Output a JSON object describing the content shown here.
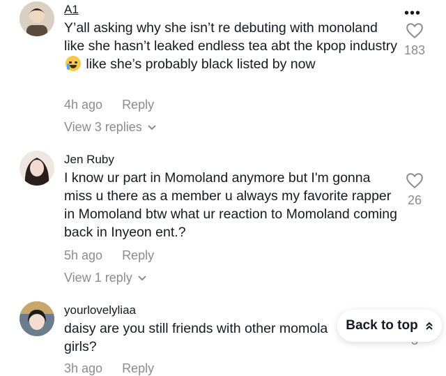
{
  "comments": [
    {
      "username": "A1",
      "text_before_emoji": "Y’all asking why she isn’t re debuting with monoland like she hasn’t leaked endless tea abt the kpop industry",
      "emoji_icon": "loudly-crying-face-icon",
      "text_after_emoji": "like she’s probably black listed by now",
      "time": "4h ago",
      "reply_label": "Reply",
      "view_replies": "View 3 replies",
      "likes": "183"
    },
    {
      "username": "Jen Ruby",
      "text": "I know ur part in Momoland anymore but I'm gonna miss u there as a member u always my favorite rapper in Momoland btw what ur reaction to Momoland coming back in Inyeon ent.?",
      "time": "5h ago",
      "reply_label": "Reply",
      "view_replies": "View 1 reply",
      "likes": "26"
    },
    {
      "username": "yourlovelyliaa",
      "text": "daisy are you still friends with other momola girls?",
      "time": "3h ago",
      "reply_label": "Reply",
      "likes": "3"
    }
  ],
  "back_to_top_label": "Back to top",
  "more_menu": "•••"
}
